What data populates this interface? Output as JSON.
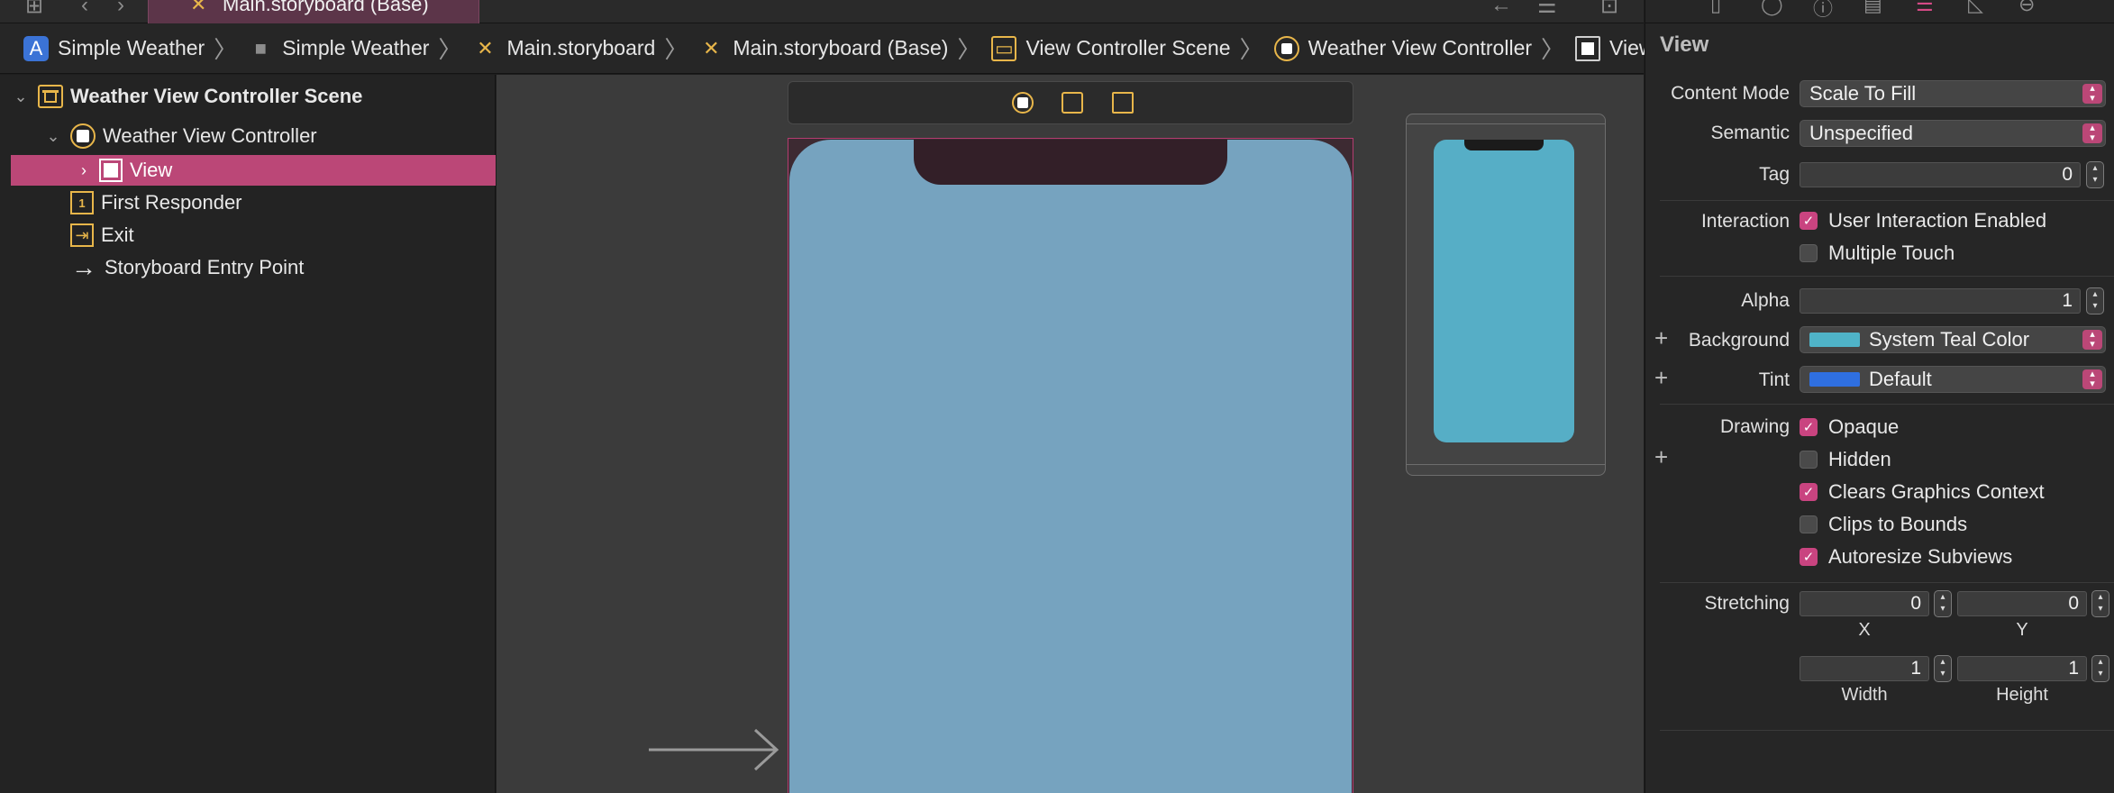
{
  "tab": {
    "title": "Main.storyboard (Base)"
  },
  "breadcrumb": [
    {
      "label": "Simple Weather",
      "icon": "app-icon"
    },
    {
      "label": "Simple Weather",
      "icon": "folder-icon"
    },
    {
      "label": "Main.storyboard",
      "icon": "storyboard-icon"
    },
    {
      "label": "Main.storyboard (Base)",
      "icon": "storyboard-icon"
    },
    {
      "label": "View Controller Scene",
      "icon": "scene-icon"
    },
    {
      "label": "Weather View Controller",
      "icon": "view-controller-icon"
    },
    {
      "label": "View",
      "icon": "view-icon"
    }
  ],
  "outline": {
    "scene": "Weather View Controller Scene",
    "view_controller": "Weather View Controller",
    "view": "View",
    "first_responder": "First Responder",
    "exit": "Exit",
    "entry_point": "Storyboard Entry Point"
  },
  "canvas": {
    "device_background": "#76a3bf",
    "preview_background": "#56aec6"
  },
  "inspector": {
    "title": "View",
    "content_mode": {
      "label": "Content Mode",
      "value": "Scale To Fill"
    },
    "semantic": {
      "label": "Semantic",
      "value": "Unspecified"
    },
    "tag": {
      "label": "Tag",
      "value": "0"
    },
    "interaction": {
      "label": "Interaction",
      "user_interaction": {
        "label": "User Interaction Enabled",
        "checked": true
      },
      "multiple_touch": {
        "label": "Multiple Touch",
        "checked": false
      }
    },
    "alpha": {
      "label": "Alpha",
      "value": "1"
    },
    "background": {
      "label": "Background",
      "value": "System Teal Color",
      "color": "#4fb3c8"
    },
    "tint": {
      "label": "Tint",
      "value": "Default",
      "color": "#2f6fe0"
    },
    "drawing": {
      "label": "Drawing",
      "opaque": {
        "label": "Opaque",
        "checked": true
      },
      "hidden": {
        "label": "Hidden",
        "checked": false
      },
      "clears_graphics": {
        "label": "Clears Graphics Context",
        "checked": true
      },
      "clips_to_bounds": {
        "label": "Clips to Bounds",
        "checked": false
      },
      "autoresize": {
        "label": "Autoresize Subviews",
        "checked": true
      }
    },
    "stretching": {
      "label": "Stretching",
      "x": {
        "value": "0",
        "label": "X"
      },
      "y": {
        "value": "0",
        "label": "Y"
      },
      "width": {
        "value": "1",
        "label": "Width"
      },
      "height": {
        "value": "1",
        "label": "Height"
      }
    }
  },
  "colors": {
    "accent": "#bb4777",
    "scene_icon": "#e8b64a"
  }
}
